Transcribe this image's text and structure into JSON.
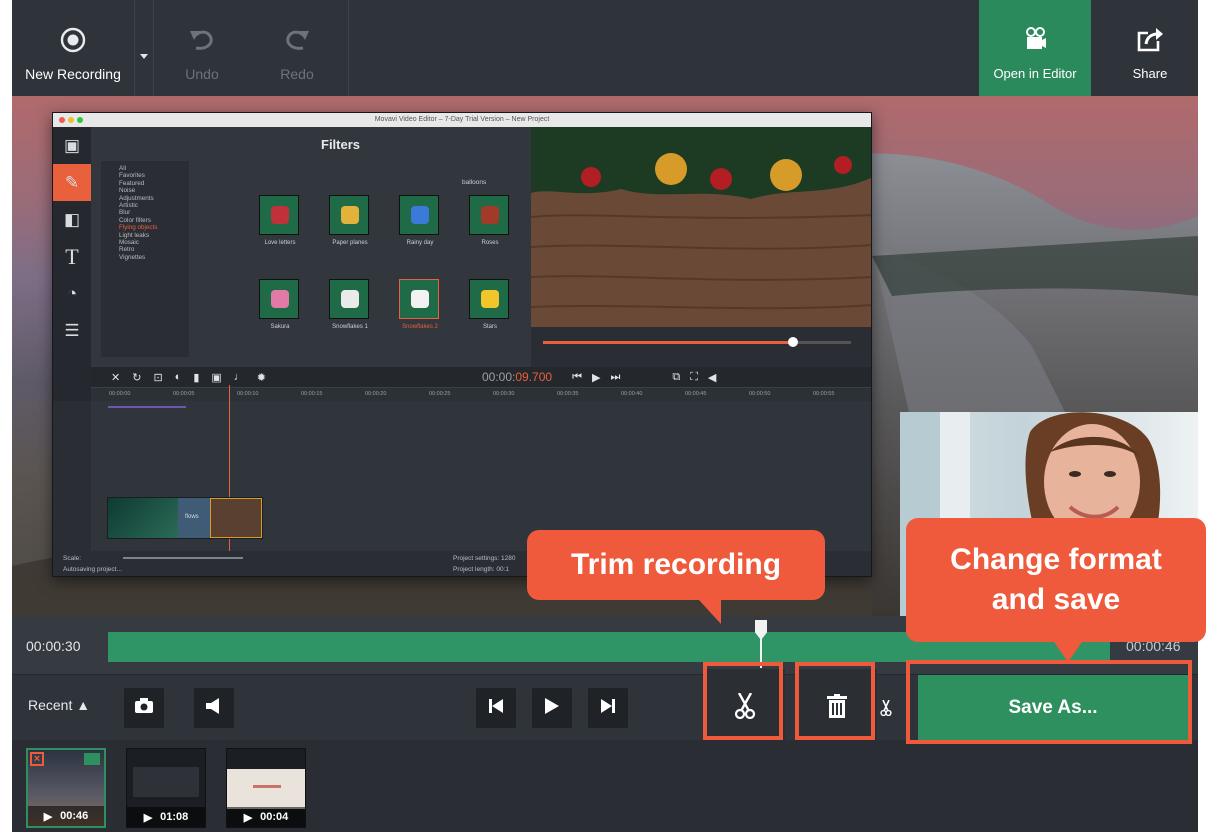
{
  "toolbar": {
    "new_recording": "New Recording",
    "undo": "Undo",
    "redo": "Redo",
    "open_in_editor": "Open in Editor",
    "share": "Share"
  },
  "editor": {
    "window_title": "Movavi Video Editor – 7-Day Trial Version – New Project",
    "filters_title": "Filters",
    "categories": [
      "All",
      "Favorites",
      "Featured",
      "Noise",
      "Adjustments",
      "Artistic",
      "Blur",
      "Color filters",
      "Flying objects",
      "Light leaks",
      "Mosaic",
      "Retro",
      "Vignettes"
    ],
    "selected_category": "Flying objects",
    "filter_header": "balloons",
    "filters": [
      "Love letters",
      "Paper planes",
      "Rainy day",
      "Roses",
      "Sakura",
      "Snowflakes 1",
      "Snowflakes 2",
      "Stars"
    ],
    "selected_filter": "Snowflakes 2",
    "timecode_prefix": "00:00:",
    "timecode_accent": "09.700",
    "ruler_ticks": [
      "00:00:00",
      "00:00:05",
      "00:00:10",
      "00:00:15",
      "00:00:20",
      "00:00:25",
      "00:00:30",
      "00:00:35",
      "00:00:40",
      "00:00:45",
      "00:00:50",
      "00:00:55"
    ],
    "clip_label": "flows",
    "scale_label": "Scale:",
    "autosave": "Autosaving project...",
    "project_settings": "Project settings: 1280",
    "project_length": "Project length: 00:1"
  },
  "timeline": {
    "start_time": "00:00:30",
    "end_time": "00:00:46"
  },
  "controls": {
    "recent_label": "Recent ▲",
    "save_as": "Save As..."
  },
  "recents": [
    {
      "duration": "00:46"
    },
    {
      "duration": "01:08"
    },
    {
      "duration": "00:04"
    }
  ],
  "callouts": {
    "trim": "Trim recording",
    "save_line1": "Change format",
    "save_line2": "and save"
  },
  "colors": {
    "accent_green": "#2e8f5f",
    "callout_red": "#ef5a3c",
    "editor_orange": "#e8603c"
  }
}
